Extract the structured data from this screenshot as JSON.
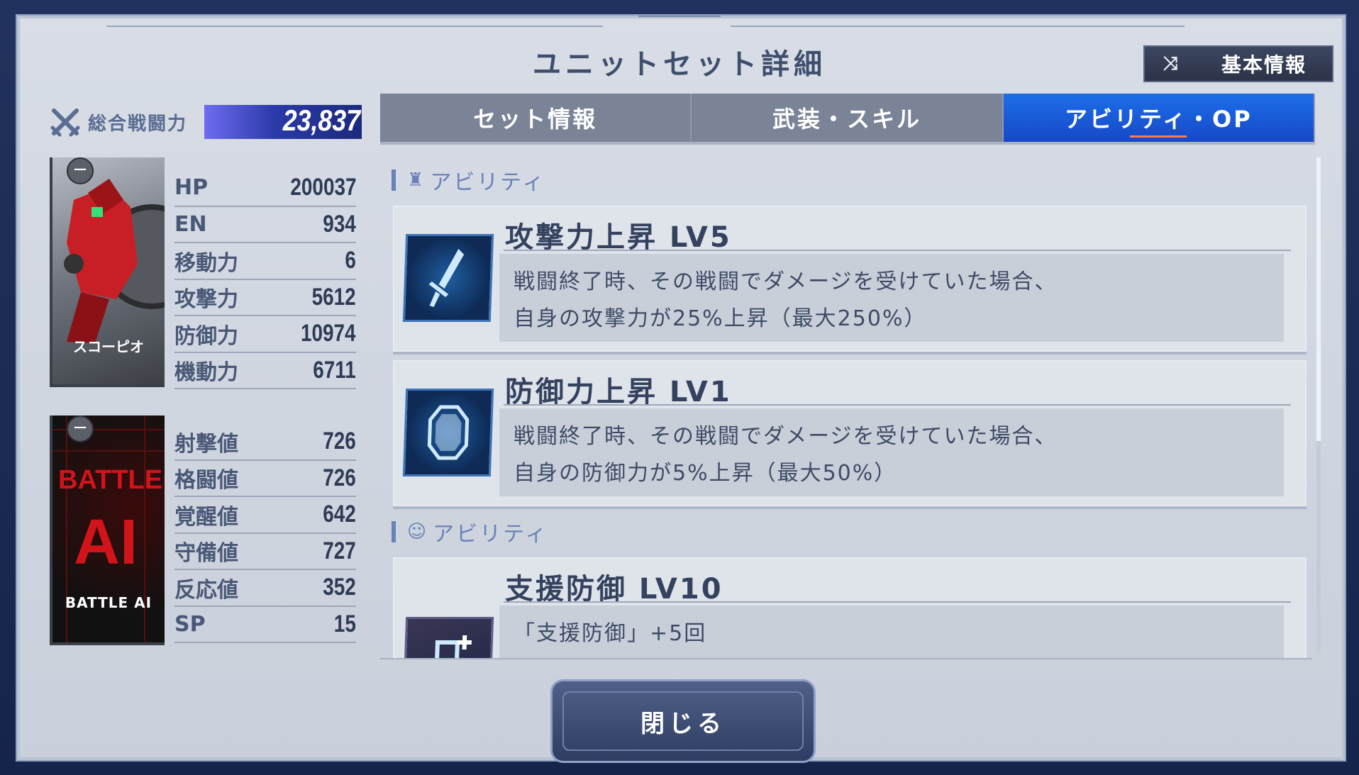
{
  "window": {
    "title": "ユニットセット詳細",
    "basic_info_button": "基本情報",
    "basic_info_icon": "shuffle-icon"
  },
  "power": {
    "label": "総合戦闘力",
    "value": "23,837"
  },
  "unit": {
    "name": "スコーピオ",
    "stats": [
      {
        "label": "HP",
        "value": "200037"
      },
      {
        "label": "EN",
        "value": "934"
      },
      {
        "label": "移動力",
        "value": "6"
      },
      {
        "label": "攻撃力",
        "value": "5612"
      },
      {
        "label": "防御力",
        "value": "10974"
      },
      {
        "label": "機動力",
        "value": "6711"
      }
    ]
  },
  "pilot": {
    "card_text_top": "BATTLE",
    "card_text_big": "AI",
    "name": "BATTLE AI",
    "stats": [
      {
        "label": "射撃値",
        "value": "726"
      },
      {
        "label": "格闘値",
        "value": "726"
      },
      {
        "label": "覚醒値",
        "value": "642"
      },
      {
        "label": "守備値",
        "value": "727"
      },
      {
        "label": "反応値",
        "value": "352"
      },
      {
        "label": "SP",
        "value": "15"
      }
    ]
  },
  "tabs": [
    {
      "label": "セット情報",
      "active": false
    },
    {
      "label": "武装・スキル",
      "active": false
    },
    {
      "label": "アビリティ・OP",
      "active": true
    }
  ],
  "sections": [
    {
      "heading": "アビリティ",
      "icon": "unit-icon",
      "abilities": [
        {
          "name": "攻撃力上昇 LV5",
          "icon": "sword-icon",
          "desc_line1": "戦闘終了時、その戦闘でダメージを受けていた場合、",
          "desc_line2": "自身の攻撃力が25%上昇（最大250%）"
        },
        {
          "name": "防御力上昇 LV1",
          "icon": "shield-icon",
          "desc_line1": "戦闘終了時、その戦闘でダメージを受けていた場合、",
          "desc_line2": "自身の防御力が5%上昇（最大50%）"
        }
      ]
    },
    {
      "heading": "アビリティ",
      "icon": "pilot-icon",
      "abilities": [
        {
          "name": "支援防御 LV10",
          "icon": "support-defense-icon",
          "desc_line1": "「支援防御」+5回"
        }
      ]
    }
  ],
  "close_button": "閉じる"
}
